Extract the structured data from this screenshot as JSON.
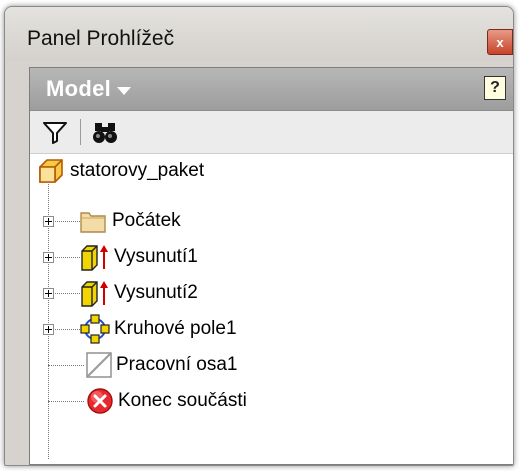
{
  "window": {
    "title": "Panel Prohlížeč",
    "close_glyph": "x"
  },
  "header": {
    "mode_label": "Model",
    "help_glyph": "?"
  },
  "toolbar": {
    "tools": [
      "filter-icon",
      "binoculars-icon"
    ]
  },
  "tree": {
    "root": {
      "label": "statorovy_paket",
      "icon": "part-cube-icon"
    },
    "items": [
      {
        "label": "Počátek",
        "icon": "folder-icon",
        "expandable": true
      },
      {
        "label": "Vysunutí1",
        "icon": "extrusion-icon",
        "expandable": true
      },
      {
        "label": "Vysunutí2",
        "icon": "extrusion-icon",
        "expandable": true
      },
      {
        "label": "Kruhové pole1",
        "icon": "circular-pattern-icon",
        "expandable": true
      },
      {
        "label": "Pracovní osa1",
        "icon": "work-axis-icon",
        "expandable": false
      },
      {
        "label": "Konec součásti",
        "icon": "end-of-part-icon",
        "expandable": false
      }
    ]
  },
  "colors": {
    "header_bg": "#a8a8a8",
    "close_red": "#c7432b",
    "folder_tan": "#f3dca8",
    "extrusion_yellow": "#f2d400",
    "end_red": "#e8282e"
  }
}
